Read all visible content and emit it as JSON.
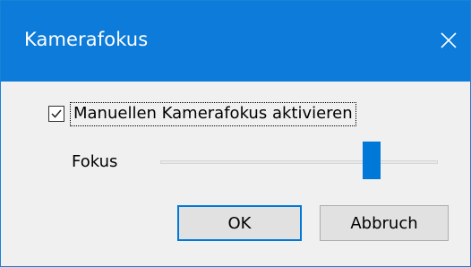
{
  "dialog": {
    "title": "Kamerafokus",
    "close_icon": "close-icon"
  },
  "manual_focus": {
    "label": "Manuellen Kamerafokus aktivieren",
    "checked": true,
    "check_icon": "checkmark-icon"
  },
  "focus": {
    "label": "Fokus",
    "slider_value_percent": 78
  },
  "buttons": {
    "ok_label": "OK",
    "cancel_label": "Abbruch"
  },
  "colors": {
    "accent": "#0078d7",
    "titlebar": "#0c7bd9"
  }
}
